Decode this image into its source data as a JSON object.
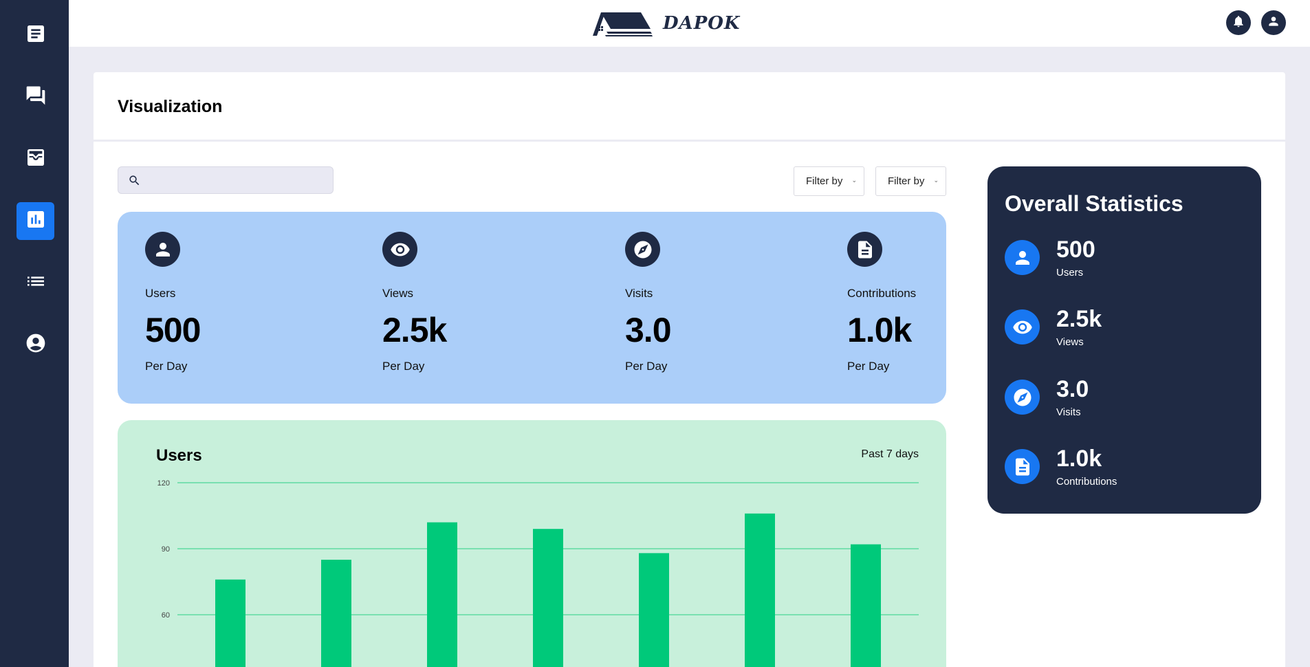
{
  "app": {
    "logo_text": "DAPOK"
  },
  "sidebar": {
    "items": [
      {
        "icon": "document-icon",
        "active": false
      },
      {
        "icon": "chat-icon",
        "active": false
      },
      {
        "icon": "inbox-icon",
        "active": false
      },
      {
        "icon": "bar-chart-icon",
        "active": true
      },
      {
        "icon": "list-icon",
        "active": false
      },
      {
        "icon": "account-icon",
        "active": false
      }
    ]
  },
  "header": {
    "icons": [
      "bell-icon",
      "user-icon"
    ]
  },
  "page": {
    "title": "Visualization"
  },
  "search": {
    "placeholder": ""
  },
  "filters": [
    {
      "label": "Filter by"
    },
    {
      "label": "Filter by"
    }
  ],
  "stats": [
    {
      "icon": "user-icon",
      "label": "Users",
      "value": "500",
      "sub": "Per Day"
    },
    {
      "icon": "eye-icon",
      "label": "Views",
      "value": "2.5k",
      "sub": "Per Day"
    },
    {
      "icon": "compass-icon",
      "label": "Visits",
      "value": "3.0",
      "sub": "Per Day"
    },
    {
      "icon": "document-icon",
      "label": "Contributions",
      "value": "1.0k",
      "sub": "Per Day"
    }
  ],
  "chart_card": {
    "title": "Users",
    "range": "Past 7 days"
  },
  "chart_data": {
    "type": "bar",
    "title": "Users",
    "xlabel": "",
    "ylabel": "",
    "y_ticks": [
      60,
      90,
      120
    ],
    "values": [
      76,
      85,
      102,
      99,
      88,
      106,
      92
    ],
    "color": "#00c97a",
    "grid": true
  },
  "overall": {
    "title": "Overall Statistics",
    "items": [
      {
        "icon": "user-icon",
        "value": "500",
        "label": "Users"
      },
      {
        "icon": "eye-icon",
        "value": "2.5k",
        "label": "Views"
      },
      {
        "icon": "compass-icon",
        "value": "3.0",
        "label": "Visits"
      },
      {
        "icon": "document-icon",
        "value": "1.0k",
        "label": "Contributions"
      }
    ]
  },
  "colors": {
    "navy": "#1f2a44",
    "accent": "#1877f2",
    "stats_bg": "#abcef9",
    "chart_bg": "#c8f0db",
    "bar": "#00c97a",
    "grid": "#5fdba2"
  }
}
